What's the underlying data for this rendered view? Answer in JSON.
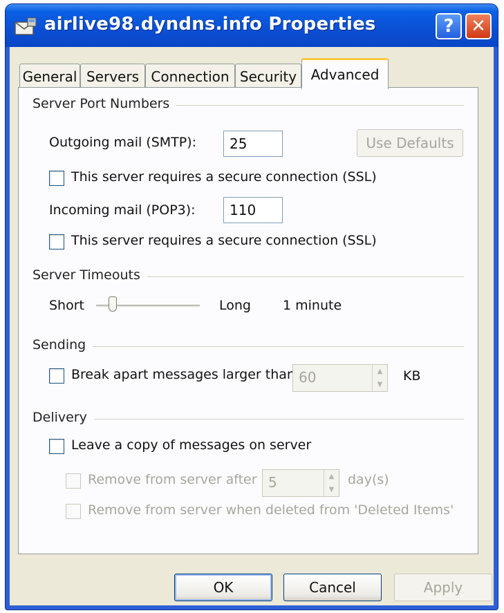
{
  "window": {
    "title": "airlive98.dyndns.info Properties",
    "help_glyph": "?",
    "close_glyph": "✕"
  },
  "tabs": [
    {
      "label": "General",
      "active": false
    },
    {
      "label": "Servers",
      "active": false
    },
    {
      "label": "Connection",
      "active": false
    },
    {
      "label": "Security",
      "active": false
    },
    {
      "label": "Advanced",
      "active": true
    }
  ],
  "server_ports": {
    "group_title": "Server Port Numbers",
    "smtp_label": "Outgoing mail (SMTP):",
    "smtp_value": "25",
    "use_defaults_label": "Use Defaults",
    "smtp_ssl_label": "This server requires a secure connection (SSL)",
    "pop3_label": "Incoming mail (POP3):",
    "pop3_value": "110",
    "pop3_ssl_label": "This server requires a secure connection (SSL)"
  },
  "timeouts": {
    "group_title": "Server Timeouts",
    "short_label": "Short",
    "long_label": "Long",
    "value_text": "1 minute"
  },
  "sending": {
    "group_title": "Sending",
    "break_apart_label": "Break apart messages larger than",
    "size_value": "60",
    "unit_label": "KB"
  },
  "delivery": {
    "group_title": "Delivery",
    "leave_copy_label": "Leave a copy of messages on server",
    "remove_after_label": "Remove from server after",
    "days_value": "5",
    "days_unit": "day(s)",
    "remove_deleted_label": "Remove from server when deleted from 'Deleted Items'"
  },
  "buttons": {
    "ok": "OK",
    "cancel": "Cancel",
    "apply": "Apply"
  },
  "colors": {
    "titlebar": "#0a5fe4",
    "active_tab_accent": "#ffc73c",
    "dialog_background": "#ece9d8"
  }
}
